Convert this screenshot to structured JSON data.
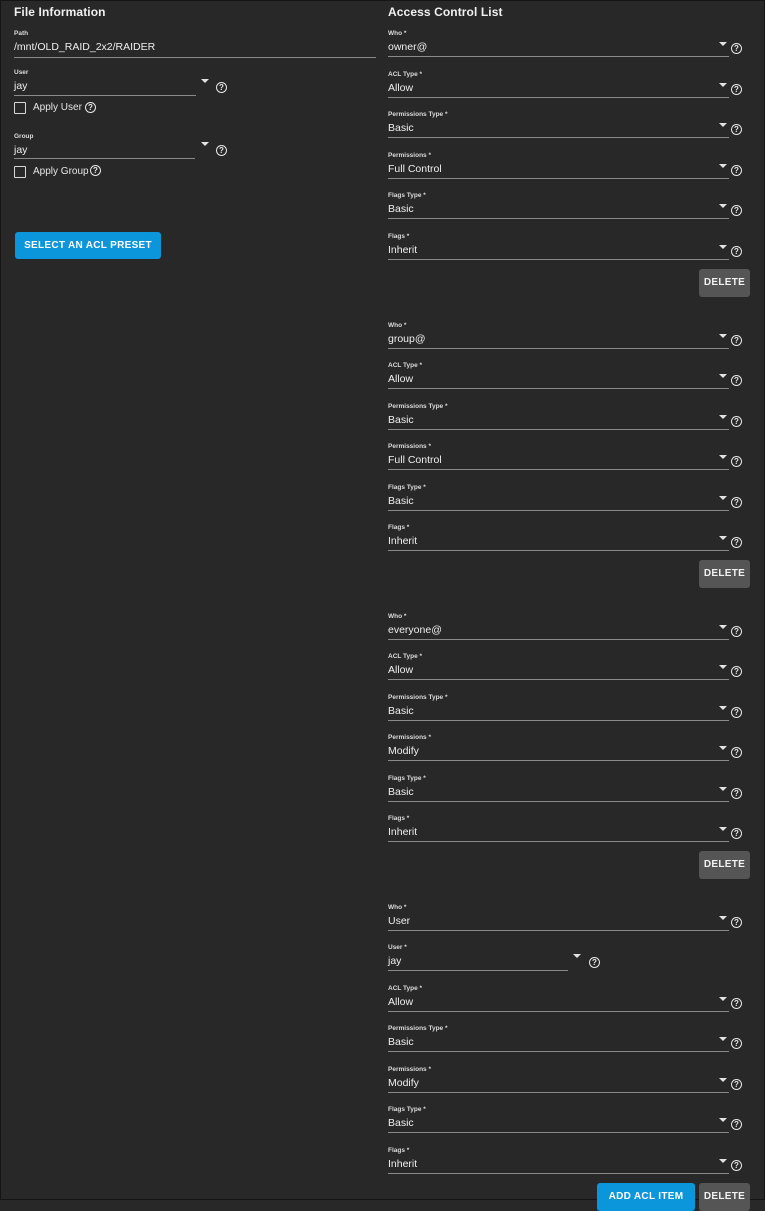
{
  "file_info": {
    "title": "File Information",
    "path": {
      "label": "Path",
      "value": "/mnt/OLD_RAID_2x2/RAIDER"
    },
    "user": {
      "label": "User",
      "value": "jay"
    },
    "apply_user_label": "Apply User",
    "group": {
      "label": "Group",
      "value": "jay"
    },
    "apply_group_label": "Apply Group",
    "preset_button": "SELECT AN ACL PRESET"
  },
  "acl": {
    "title": "Access Control List",
    "help_icon": "help-circle-icon",
    "entries": [
      {
        "fields": [
          {
            "label": "Who *",
            "value": "owner@"
          },
          {
            "label": "ACL Type *",
            "value": "Allow"
          },
          {
            "label": "Permissions Type *",
            "value": "Basic"
          },
          {
            "label": "Permissions *",
            "value": "Full Control"
          },
          {
            "label": "Flags Type *",
            "value": "Basic"
          },
          {
            "label": "Flags *",
            "value": "Inherit"
          }
        ],
        "delete_label": "DELETE"
      },
      {
        "fields": [
          {
            "label": "Who *",
            "value": "group@"
          },
          {
            "label": "ACL Type *",
            "value": "Allow"
          },
          {
            "label": "Permissions Type *",
            "value": "Basic"
          },
          {
            "label": "Permissions *",
            "value": "Full Control"
          },
          {
            "label": "Flags Type *",
            "value": "Basic"
          },
          {
            "label": "Flags *",
            "value": "Inherit"
          }
        ],
        "delete_label": "DELETE"
      },
      {
        "fields": [
          {
            "label": "Who *",
            "value": "everyone@"
          },
          {
            "label": "ACL Type *",
            "value": "Allow"
          },
          {
            "label": "Permissions Type *",
            "value": "Basic"
          },
          {
            "label": "Permissions *",
            "value": "Modify"
          },
          {
            "label": "Flags Type *",
            "value": "Basic"
          },
          {
            "label": "Flags *",
            "value": "Inherit"
          }
        ],
        "delete_label": "DELETE"
      },
      {
        "fields": [
          {
            "label": "Who *",
            "value": "User"
          },
          {
            "label": "User *",
            "value": "jay",
            "short": true
          },
          {
            "label": "ACL Type *",
            "value": "Allow"
          },
          {
            "label": "Permissions Type *",
            "value": "Basic"
          },
          {
            "label": "Permissions *",
            "value": "Modify"
          },
          {
            "label": "Flags Type *",
            "value": "Basic"
          },
          {
            "label": "Flags *",
            "value": "Inherit"
          }
        ],
        "delete_label": "DELETE",
        "add_label": "ADD ACL ITEM"
      }
    ]
  }
}
